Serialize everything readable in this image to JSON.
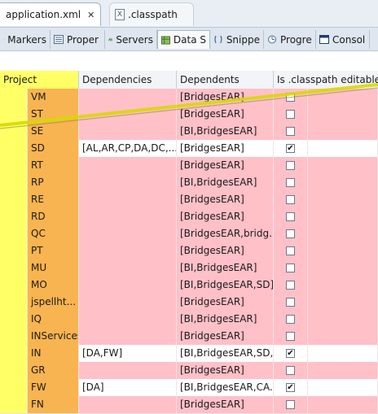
{
  "editor_tabs": [
    {
      "label": "application.xml",
      "close": "✕"
    },
    {
      "label": ".classpath",
      "icon_text": "X"
    }
  ],
  "view_tabs": [
    "Markers",
    "Proper",
    "Servers",
    "Data S",
    "Snippe",
    "Progre",
    "Consol"
  ],
  "table": {
    "headers": [
      "Project",
      "Dependencies",
      "Dependents",
      "Is .classpath editable?"
    ],
    "rows": [
      {
        "project": "VM",
        "dependencies": "",
        "dependents": "[BridgesEAR]",
        "editable": false
      },
      {
        "project": "ST",
        "dependencies": "",
        "dependents": "[BridgesEAR]",
        "editable": false
      },
      {
        "project": "SE",
        "dependencies": "",
        "dependents": "[BI,BridgesEAR]",
        "editable": false
      },
      {
        "project": "SD",
        "dependencies": "[AL,AR,CP,DA,DC,...",
        "dependents": "[BridgesEAR]",
        "editable": true
      },
      {
        "project": "RT",
        "dependencies": "",
        "dependents": "[BridgesEAR]",
        "editable": false
      },
      {
        "project": "RP",
        "dependencies": "",
        "dependents": "[BI,BridgesEAR]",
        "editable": false
      },
      {
        "project": "RE",
        "dependencies": "",
        "dependents": "[BridgesEAR]",
        "editable": false
      },
      {
        "project": "RD",
        "dependencies": "",
        "dependents": "[BridgesEAR]",
        "editable": false
      },
      {
        "project": "QC",
        "dependencies": "",
        "dependents": "[BridgesEAR,bridg...",
        "editable": false
      },
      {
        "project": "PT",
        "dependencies": "",
        "dependents": "[BridgesEAR]",
        "editable": false
      },
      {
        "project": "MU",
        "dependencies": "",
        "dependents": "[BI,BridgesEAR]",
        "editable": false
      },
      {
        "project": "MO",
        "dependencies": "",
        "dependents": "[BI,BridgesEAR,SD]",
        "editable": false
      },
      {
        "project": "jspellht...",
        "dependencies": "",
        "dependents": "[BridgesEAR]",
        "editable": false
      },
      {
        "project": "IQ",
        "dependencies": "",
        "dependents": "[BI,BridgesEAR]",
        "editable": false
      },
      {
        "project": "INServices",
        "dependencies": "",
        "dependents": "[BridgesEAR]",
        "editable": false
      },
      {
        "project": "IN",
        "dependencies": "[DA,FW]",
        "dependents": "[BI,BridgesEAR,SD,...",
        "editable": true
      },
      {
        "project": "GR",
        "dependencies": "",
        "dependents": "[BridgesEAR]",
        "editable": false
      },
      {
        "project": "FW",
        "dependencies": "[DA]",
        "dependents": "[BI,BridgesEAR,CA...",
        "editable": true
      },
      {
        "project": "FN",
        "dependencies": "",
        "dependents": "[BridgesEAR]",
        "editable": false
      }
    ]
  },
  "colors": {
    "project_column": "#ffff66",
    "name_cell": "#f8b450",
    "non_editable_row": "#ffc0c8",
    "editable_row": "#ffffff"
  }
}
